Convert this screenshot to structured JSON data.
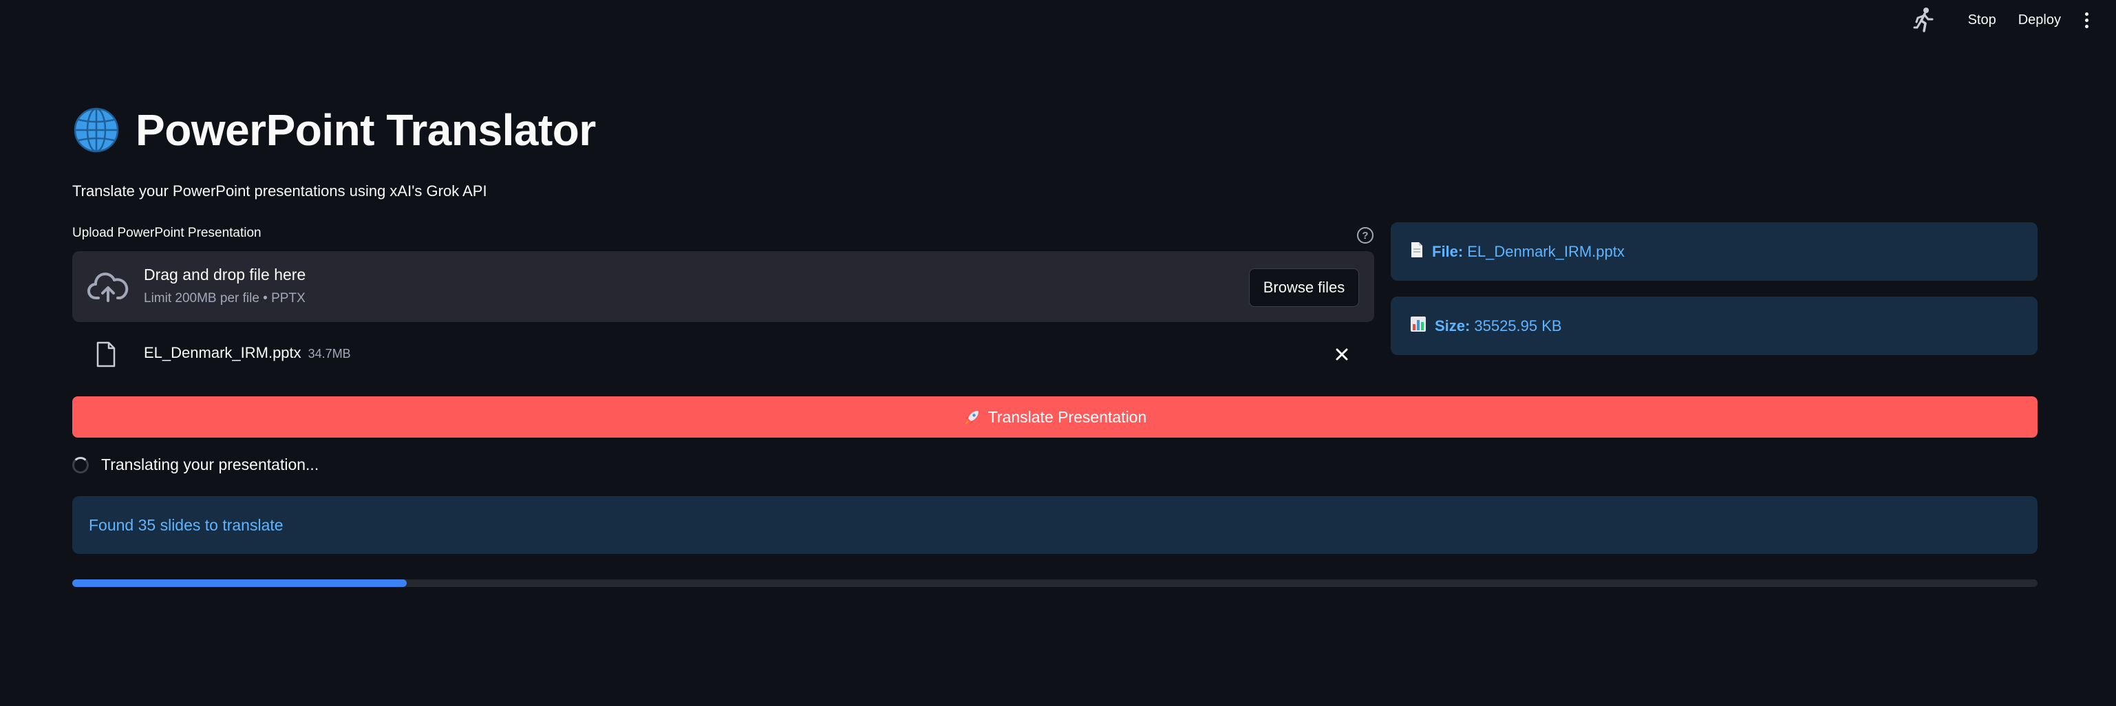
{
  "header": {
    "running_icon": "running-man-icon",
    "stop_label": "Stop",
    "deploy_label": "Deploy",
    "menu_icon": "kebab-menu-icon"
  },
  "app": {
    "title_icon": "globe-icon",
    "title": "PowerPoint Translator",
    "subtitle": "Translate your PowerPoint presentations using xAI's Grok API"
  },
  "uploader": {
    "label": "Upload PowerPoint Presentation",
    "help_icon": "question-circle-icon",
    "drop_text": "Drag and drop file here",
    "limit_text": "Limit 200MB per file • PPTX",
    "browse_label": "Browse files",
    "file": {
      "name": "EL_Denmark_IRM.pptx",
      "size": "34.7MB"
    }
  },
  "file_info": {
    "file_label": "File:",
    "file_value": "EL_Denmark_IRM.pptx",
    "size_label": "Size:",
    "size_value": "35525.95 KB"
  },
  "actions": {
    "translate_label": "Translate Presentation"
  },
  "status": {
    "spinner_text": "Translating your presentation...",
    "info_message": "Found 35 slides to translate",
    "progress_percent": 17
  },
  "colors": {
    "background": "#0e1117",
    "primary_button": "#ff5a5a",
    "info_bg": "#172d43",
    "info_text": "#60b4ff",
    "progress": "#3b82f6"
  }
}
